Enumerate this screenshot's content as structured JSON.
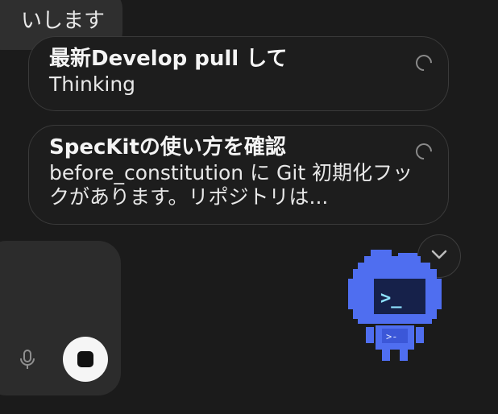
{
  "previous_message": {
    "text": "いします"
  },
  "tasks": [
    {
      "title": "最新Develop pull して",
      "status": "Thinking"
    },
    {
      "title": "SpecKitの使い方を確認",
      "status": "before_constitution に Git 初期化フックがあります。リポジトリは..."
    }
  ],
  "mascot": {
    "screen_text": ">_",
    "chest_text": ">-"
  },
  "colors": {
    "background": "#1b1b1b",
    "card_border": "#3a3a3a",
    "input_bg": "#2c2c2c",
    "mascot_blue": "#4f6ef0"
  },
  "icons": {
    "spinner": "loading-spinner-icon",
    "mic": "microphone-icon",
    "stop": "stop-icon",
    "scroll": "chevron-down-icon"
  }
}
